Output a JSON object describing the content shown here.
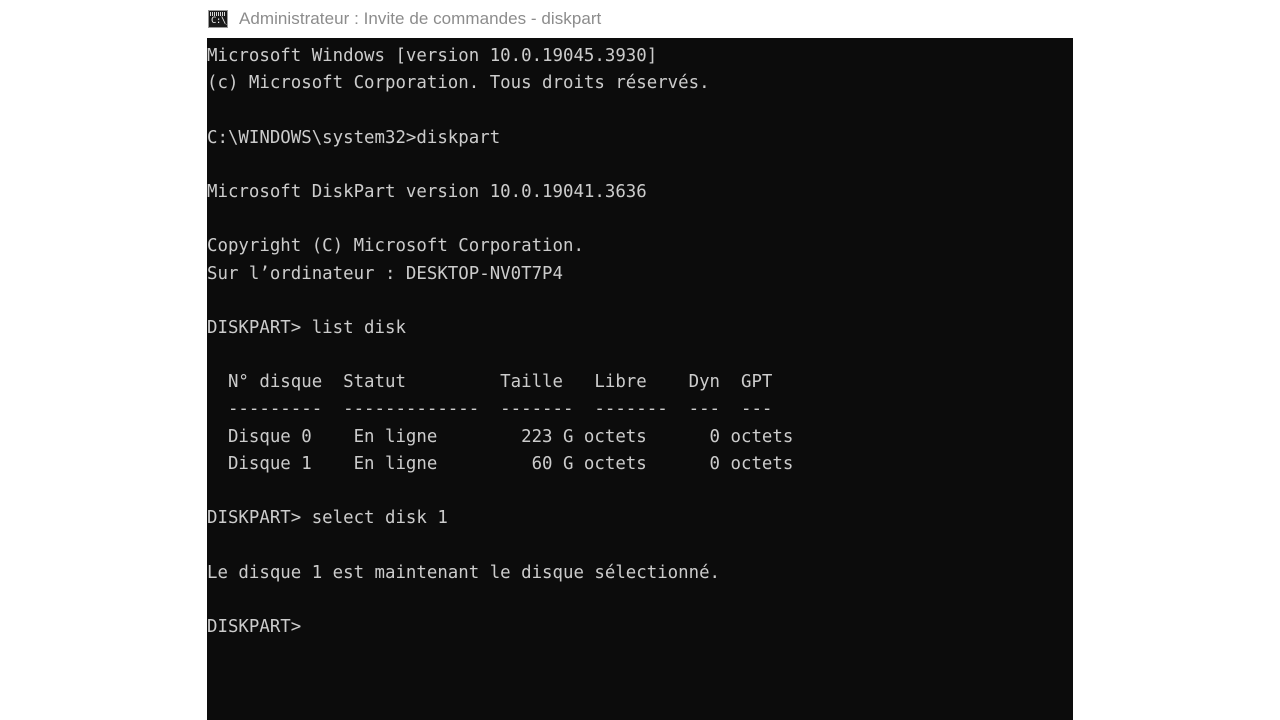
{
  "window": {
    "title": "Administrateur : Invite de commandes - diskpart",
    "icon": "console-icon",
    "icon_glyph": "C:\\_",
    "colors": {
      "console_background": "#0c0c0c",
      "console_foreground": "#cccccc",
      "titlebar_background": "#ffffff",
      "titlebar_foreground": "#8c8c8c",
      "page_background": "#ffffff"
    }
  },
  "console": {
    "lines": [
      "Microsoft Windows [version 10.0.19045.3930]",
      "(c) Microsoft Corporation. Tous droits réservés.",
      "",
      "C:\\WINDOWS\\system32>diskpart",
      "",
      "Microsoft DiskPart version 10.0.19041.3636",
      "",
      "Copyright (C) Microsoft Corporation.",
      "Sur l’ordinateur : DESKTOP-NV0T7P4",
      "",
      "DISKPART> list disk",
      "",
      "  N° disque  Statut         Taille   Libre    Dyn  GPT",
      "  ---------  -------------  -------  -------  ---  ---",
      "  Disque 0    En ligne        223 G octets      0 octets",
      "  Disque 1    En ligne         60 G octets      0 octets",
      "",
      "DISKPART> select disk 1",
      "",
      "Le disque 1 est maintenant le disque sélectionné.",
      "",
      "DISKPART>"
    ],
    "os_banner": {
      "product": "Microsoft Windows",
      "version": "10.0.19045.3930",
      "copyright": "(c) Microsoft Corporation. Tous droits réservés."
    },
    "prompt_path": "C:\\WINDOWS\\system32>",
    "launched_command": "diskpart",
    "diskpart_banner": {
      "product": "Microsoft DiskPart version",
      "version": "10.0.19041.3636",
      "copyright": "Copyright (C) Microsoft Corporation.",
      "computer_label": "Sur l’ordinateur :",
      "computer_name": "DESKTOP-NV0T7P4"
    },
    "diskpart_prompt": "DISKPART>",
    "commands": [
      "list disk",
      "select disk 1"
    ],
    "disk_table": {
      "headers": [
        "N° disque",
        "Statut",
        "Taille",
        "Libre",
        "Dyn",
        "GPT"
      ],
      "separators": [
        "---------",
        "-------------",
        "-------",
        "-------",
        "---",
        "---"
      ],
      "rows": [
        {
          "disque": "Disque 0",
          "statut": "En ligne",
          "taille": "223 G octets",
          "libre": "0 octets",
          "dyn": "",
          "gpt": ""
        },
        {
          "disque": "Disque 1",
          "statut": "En ligne",
          "taille": "60 G octets",
          "libre": "0 octets",
          "dyn": "",
          "gpt": ""
        }
      ]
    },
    "result_message": "Le disque 1 est maintenant le disque sélectionné.",
    "cursor_prompt": "DISKPART>"
  }
}
